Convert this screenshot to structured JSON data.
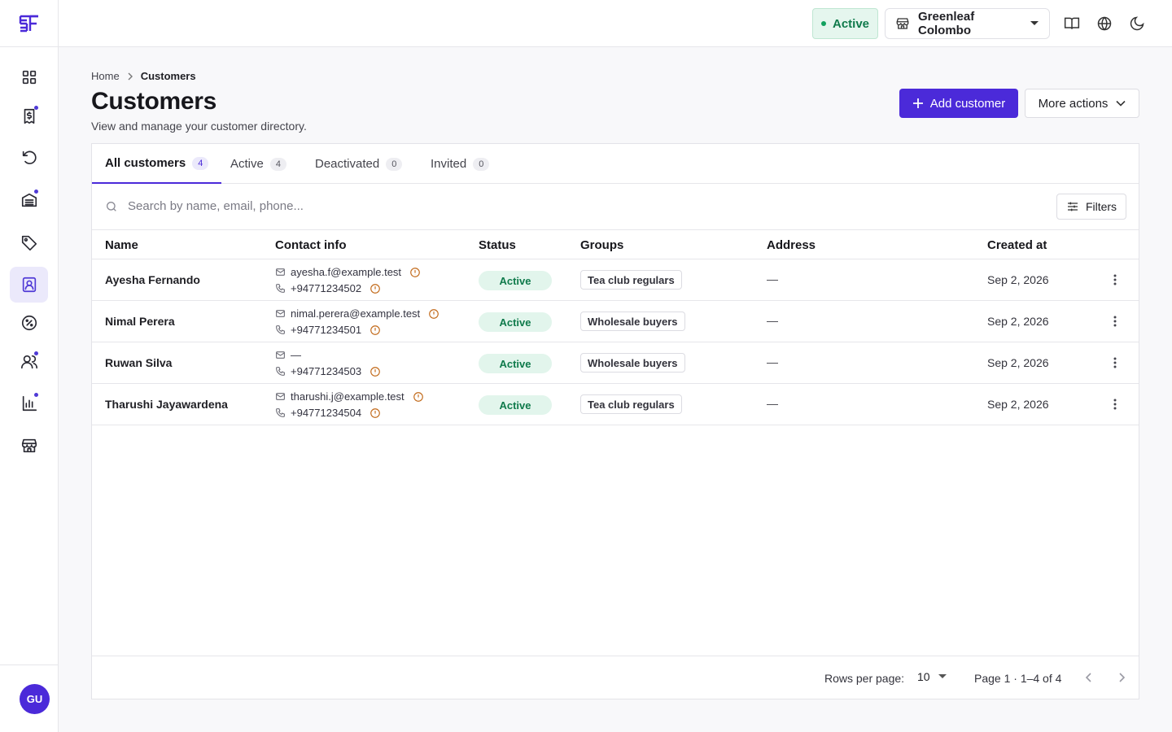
{
  "app": {
    "logo_text": "SF",
    "user_initials": "GU"
  },
  "sidebar": {
    "items": [
      {
        "name": "dashboard-icon",
        "active": false,
        "dot": false
      },
      {
        "name": "billing-icon",
        "active": false,
        "dot": true
      },
      {
        "name": "refresh-icon",
        "active": false,
        "dot": false
      },
      {
        "name": "inventory-icon",
        "active": false,
        "dot": true
      },
      {
        "name": "tag-icon",
        "active": false,
        "dot": false
      },
      {
        "name": "customers-icon",
        "active": true,
        "dot": false
      },
      {
        "name": "discount-icon",
        "active": false,
        "dot": false
      },
      {
        "name": "team-icon",
        "active": false,
        "dot": true
      },
      {
        "name": "reports-icon",
        "active": false,
        "dot": true
      },
      {
        "name": "store-icon",
        "active": false,
        "dot": false
      }
    ]
  },
  "header": {
    "status_label": "Active",
    "store_name": "Greenleaf Colombo"
  },
  "breadcrumb": {
    "home": "Home",
    "current": "Customers"
  },
  "page": {
    "title": "Customers",
    "subtitle": "View and manage your customer directory.",
    "add_button": "Add customer",
    "more_button": "More actions"
  },
  "tabs": [
    {
      "label": "All customers",
      "count": "4"
    },
    {
      "label": "Active",
      "count": "4"
    },
    {
      "label": "Deactivated",
      "count": "0"
    },
    {
      "label": "Invited",
      "count": "0"
    }
  ],
  "search": {
    "placeholder": "Search by name, email, phone...",
    "filters_label": "Filters"
  },
  "table": {
    "columns": [
      "Name",
      "Contact info",
      "Status",
      "Groups",
      "Address",
      "Created at"
    ],
    "rows": [
      {
        "name": "Ayesha Fernando",
        "email": "ayesha.f@example.test",
        "email_warn": true,
        "phone": "+94771234502",
        "status": "Active",
        "group": "Tea club regulars",
        "address": "—",
        "created": "Sep 2, 2026"
      },
      {
        "name": "Nimal Perera",
        "email": "nimal.perera@example.test",
        "email_warn": true,
        "phone": "+94771234501",
        "status": "Active",
        "group": "Wholesale buyers",
        "address": "—",
        "created": "Sep 2, 2026"
      },
      {
        "name": "Ruwan Silva",
        "email": "—",
        "email_warn": false,
        "phone": "+94771234503",
        "status": "Active",
        "group": "Wholesale buyers",
        "address": "—",
        "created": "Sep 2, 2026"
      },
      {
        "name": "Tharushi Jayawardena",
        "email": "tharushi.j@example.test",
        "email_warn": true,
        "phone": "+94771234504",
        "status": "Active",
        "group": "Tea club regulars",
        "address": "—",
        "created": "Sep 2, 2026"
      }
    ]
  },
  "pagination": {
    "rows_per_page_label": "Rows per page:",
    "rows_per_page": "10",
    "page_info": "Page 1 · 1–4 of 4"
  }
}
